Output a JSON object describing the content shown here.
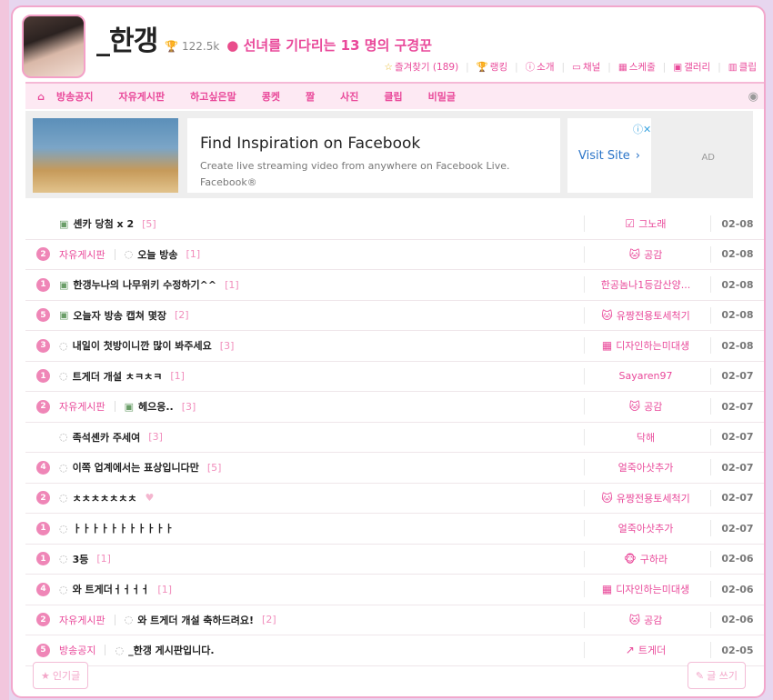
{
  "header": {
    "channel_name": "_한갱",
    "fan_count": "122.5k",
    "status": "선녀를 기다리는 13 명의 구경꾼",
    "quick_links": [
      {
        "label": "즐겨찾기 (189)",
        "icon": "star-icon"
      },
      {
        "label": "랭킹",
        "icon": "trophy-icon"
      },
      {
        "label": "소개",
        "icon": "info-icon"
      },
      {
        "label": "채널",
        "icon": "monitor-icon"
      },
      {
        "label": "스케줄",
        "icon": "calendar-icon"
      },
      {
        "label": "갤러리",
        "icon": "image-icon"
      },
      {
        "label": "클립",
        "icon": "film-icon"
      }
    ]
  },
  "nav": {
    "items": [
      "방송공지",
      "자유게시판",
      "하고싶은말",
      "콩켓",
      "짤",
      "사진",
      "클립",
      "비밀글"
    ]
  },
  "ad": {
    "title": "Find Inspiration on Facebook",
    "description": "Create live streaming video from anywhere on Facebook Live.",
    "brand": "Facebook®",
    "visit_label": "Visit Site",
    "ad_label": "AD"
  },
  "posts": [
    {
      "badge": "",
      "category": "",
      "icon": "image-icon",
      "title": "셴카 당첨 x 2",
      "count": "[5]",
      "author": "그노래",
      "author_icon": "check-icon",
      "date": "02-08"
    },
    {
      "badge": "2",
      "category": "자유게시판",
      "icon": "chat-icon",
      "title": "오늘 방송",
      "count": "[1]",
      "author": "공감",
      "author_icon": "cat-icon",
      "date": "02-08"
    },
    {
      "badge": "1",
      "category": "",
      "icon": "image-icon",
      "title": "한갱누나의 나무위키 수정하기^^",
      "count": "[1]",
      "author": "한공놈나1등감산양...",
      "author_icon": "",
      "date": "02-08"
    },
    {
      "badge": "5",
      "category": "",
      "icon": "image-icon",
      "title": "오늘자 방송 캡쳐 몇장",
      "count": "[2]",
      "author": "유짱전용토세척기",
      "author_icon": "cat-icon",
      "date": "02-08"
    },
    {
      "badge": "3",
      "category": "",
      "icon": "chat-icon",
      "title": "내일이 첫방이니깐 많이 봐주세요",
      "count": "[3]",
      "author": "디자인하는미대생",
      "author_icon": "calendar-icon",
      "date": "02-08"
    },
    {
      "badge": "1",
      "category": "",
      "icon": "chat-icon",
      "title": "트게더 개설 ㅊㅋㅊㅋ",
      "count": "[1]",
      "author": "Sayaren97",
      "author_icon": "",
      "date": "02-07"
    },
    {
      "badge": "2",
      "category": "자유게시판",
      "icon": "image-icon",
      "title": "헤으응..",
      "count": "[3]",
      "author": "공감",
      "author_icon": "cat-icon",
      "date": "02-07"
    },
    {
      "badge": "",
      "category": "",
      "icon": "chat-icon",
      "title": "족석셴카 주세여",
      "count": "[3]",
      "author": "닥해",
      "author_icon": "",
      "date": "02-07"
    },
    {
      "badge": "4",
      "category": "",
      "icon": "chat-icon",
      "title": "이쪽 업계에서는 표상입니다만",
      "count": "[5]",
      "author": "얼죽아삿추가",
      "author_icon": "",
      "date": "02-07"
    },
    {
      "badge": "2",
      "category": "",
      "icon": "chat-icon",
      "title": "ㅊㅊㅊㅊㅊㅊㅊ",
      "count": "",
      "author": "유짱전용토세척기",
      "author_icon": "cat-icon",
      "date": "02-07",
      "heart": true
    },
    {
      "badge": "1",
      "category": "",
      "icon": "chat-icon",
      "title": "ㅏㅏㅏㅏㅏㅏㅏㅏㅏㅏㅏ",
      "count": "",
      "author": "얼죽아삿추가",
      "author_icon": "",
      "date": "02-07"
    },
    {
      "badge": "1",
      "category": "",
      "icon": "chat-icon",
      "title": "3등",
      "count": "[1]",
      "author": "구하라",
      "author_icon": "monkey-icon",
      "date": "02-06"
    },
    {
      "badge": "4",
      "category": "",
      "icon": "chat-icon",
      "title": "와 트게더ㅓㅓㅓㅓ",
      "count": "[1]",
      "author": "디자인하는미대생",
      "author_icon": "calendar-icon",
      "date": "02-06"
    },
    {
      "badge": "2",
      "category": "자유게시판",
      "icon": "chat-icon",
      "title": "와 트게더 개설 축하드려요!",
      "count": "[2]",
      "author": "공감",
      "author_icon": "cat-icon",
      "date": "02-06"
    },
    {
      "badge": "5",
      "category": "방송공지",
      "icon": "chat-icon",
      "title": "_한갱 게시판입니다.",
      "count": "",
      "author": "트게더",
      "author_icon": "logo-icon",
      "date": "02-05"
    }
  ],
  "buttons": {
    "popular": "인기글",
    "write": "글 쓰기"
  }
}
